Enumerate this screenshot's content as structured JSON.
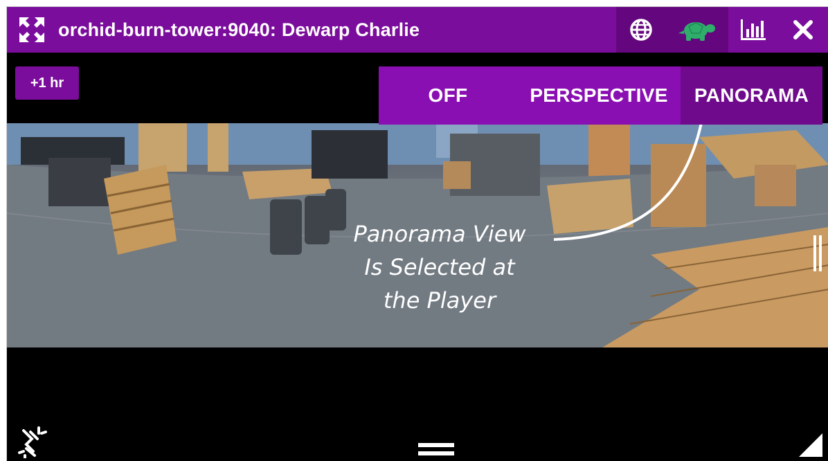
{
  "window": {
    "title": "orchid-burn-tower:9040: Dewarp Charlie"
  },
  "icons": {
    "expand": "expand-arrows-icon",
    "globe": "globe-icon",
    "turtle": "turtle-icon",
    "stats": "bar-chart-icon",
    "close": "close-icon",
    "link": "broken-link-icon",
    "drag": "drag-handle-icon",
    "resize": "resize-corner-icon"
  },
  "player": {
    "time_offset": "+1 hr"
  },
  "dewarp": {
    "options": [
      "OFF",
      "PERSPECTIVE",
      "PANORAMA"
    ],
    "selected": "PANORAMA"
  },
  "annotation": {
    "line1": "Panorama View",
    "line2": "Is Selected at",
    "line3": "the Player"
  },
  "colors": {
    "accent": "#7b0d9c",
    "accent_dark": "#64077e",
    "turtle": "#2fae6b"
  }
}
